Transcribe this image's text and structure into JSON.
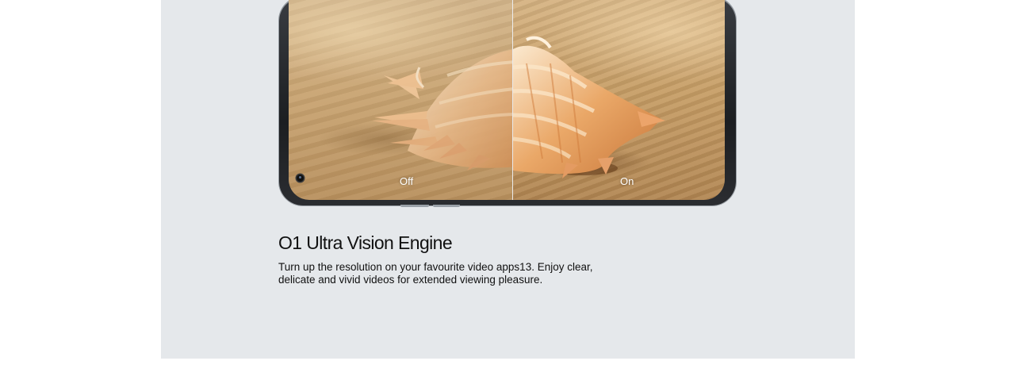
{
  "comparison": {
    "label_off": "Off",
    "label_on": "On",
    "image_subject": "seashell-on-sand"
  },
  "feature": {
    "title": "O1 Ultra Vision Engine",
    "description": "Turn up the resolution on your favourite video apps13. Enjoy clear, delicate and vivid videos for extended viewing pleasure."
  },
  "colors": {
    "panel_background": "#e5e8eb",
    "phone_frame": "#1c1e21",
    "text": "#111111"
  }
}
